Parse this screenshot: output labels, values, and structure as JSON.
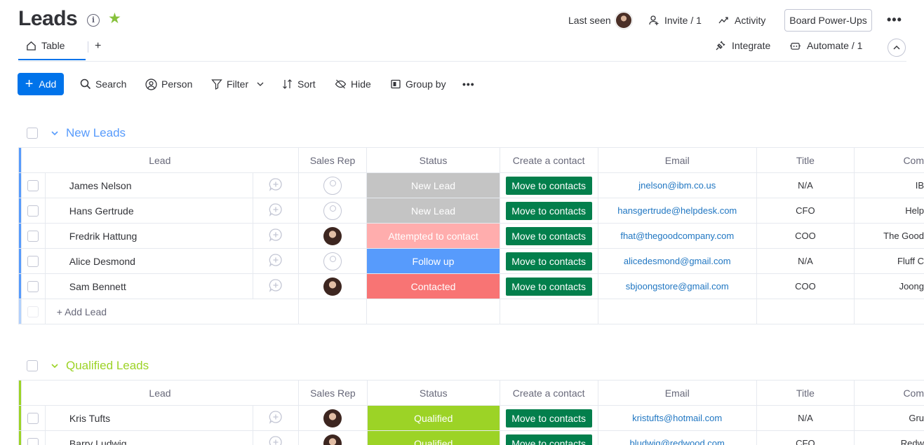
{
  "header": {
    "title": "Leads",
    "last_seen_label": "Last seen",
    "invite_label": "Invite / 1",
    "activity_label": "Activity",
    "powerups_label": "Board Power-Ups",
    "more_label": "•••"
  },
  "tabs": {
    "table_label": "Table",
    "add_label": "+",
    "integrate_label": "Integrate",
    "automate_label": "Automate / 1"
  },
  "toolbar": {
    "add_label": "Add",
    "search_label": "Search",
    "person_label": "Person",
    "filter_label": "Filter",
    "sort_label": "Sort",
    "hide_label": "Hide",
    "groupby_label": "Group by",
    "more_label": "•••"
  },
  "columns": {
    "lead": "Lead",
    "sales_rep": "Sales Rep",
    "status": "Status",
    "create_contact": "Create a contact",
    "email": "Email",
    "title": "Title",
    "company": "Com"
  },
  "colors": {
    "new_leads": "#579bfc",
    "qualified_leads": "#9cd326",
    "accent": "#0073ea",
    "move_button": "#037f4c"
  },
  "groups": [
    {
      "name": "New Leads",
      "color": "#579bfc",
      "add_label": "+ Add Lead",
      "rows": [
        {
          "lead": "James Nelson",
          "rep": "empty",
          "status": "New Lead",
          "status_color": "#c4c4c4",
          "action": "Move to contacts",
          "email": "jnelson@ibm.co.us",
          "title": "N/A",
          "company": "IB"
        },
        {
          "lead": "Hans Gertrude",
          "rep": "empty",
          "status": "New Lead",
          "status_color": "#c4c4c4",
          "action": "Move to contacts",
          "email": "hansgertrude@helpdesk.com",
          "title": "CFO",
          "company": "Help"
        },
        {
          "lead": "Fredrik Hattung",
          "rep": "avatar",
          "status": "Attempted to contact",
          "status_color": "#ffadad",
          "action": "Move to contacts",
          "email": "fhat@thegoodcompany.com",
          "title": "COO",
          "company": "The Good"
        },
        {
          "lead": "Alice Desmond",
          "rep": "empty",
          "status": "Follow up",
          "status_color": "#579bfc",
          "action": "Move to contacts",
          "email": "alicedesmond@gmail.com",
          "title": "N/A",
          "company": "Fluff C"
        },
        {
          "lead": "Sam Bennett",
          "rep": "avatar",
          "status": "Contacted",
          "status_color": "#f87474",
          "action": "Move to contacts",
          "email": "sbjoongstore@gmail.com",
          "title": "COO",
          "company": "Joong"
        }
      ]
    },
    {
      "name": "Qualified Leads",
      "color": "#9cd326",
      "rows": [
        {
          "lead": "Kris Tufts",
          "rep": "avatar",
          "status": "Qualified",
          "status_color": "#9cd326",
          "action": "Move to contacts",
          "email": "kristufts@hotmail.com",
          "title": "N/A",
          "company": "Gru"
        },
        {
          "lead": "Barry Ludwig",
          "rep": "avatar",
          "status": "Qualified",
          "status_color": "#9cd326",
          "action": "Move to contacts",
          "email": "bludwig@redwood.com",
          "title": "CFO",
          "company": "Redw"
        }
      ]
    }
  ]
}
